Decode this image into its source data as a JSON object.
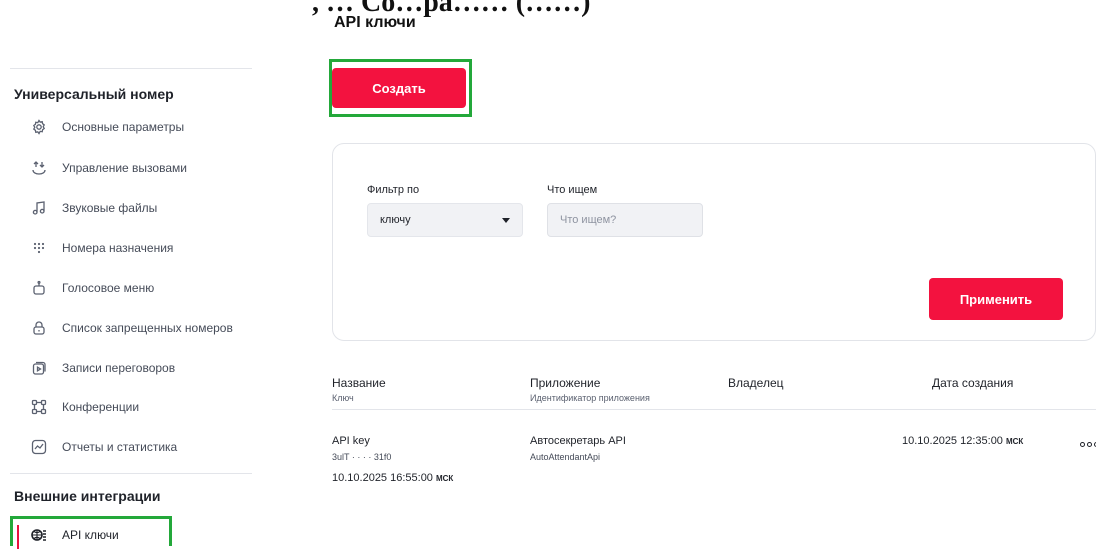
{
  "page": {
    "title_fragment": ", … Со…ра…… (……)",
    "title": "API ключи",
    "create_label": "Создать"
  },
  "sidebar": {
    "group1_title": "Универсальный номер",
    "items": [
      {
        "label": "Основные параметры",
        "icon": "gear-icon"
      },
      {
        "label": "Управление вызовами",
        "icon": "call-routing-icon"
      },
      {
        "label": "Звуковые файлы",
        "icon": "music-note-icon"
      },
      {
        "label": "Номера назначения",
        "icon": "dialpad-icon"
      },
      {
        "label": "Голосовое меню",
        "icon": "robot-icon"
      },
      {
        "label": "Список запрещенных номеров",
        "icon": "lock-icon"
      },
      {
        "label": "Записи переговоров",
        "icon": "recording-icon"
      },
      {
        "label": "Конференции",
        "icon": "conference-icon"
      },
      {
        "label": "Отчеты и статистика",
        "icon": "chart-icon"
      }
    ],
    "group2_title": "Внешние интеграции",
    "active_item": {
      "label": "API ключи",
      "icon": "api-key-icon"
    }
  },
  "filter": {
    "filter_by_label": "Фильтр по",
    "filter_by_value": "ключу",
    "search_label": "Что ищем",
    "search_placeholder": "Что ищем?",
    "apply_label": "Применить"
  },
  "table": {
    "headers": {
      "name": "Название",
      "name_sub": "Ключ",
      "app": "Приложение",
      "app_sub": "Идентификатор приложения",
      "owner": "Владелец",
      "created": "Дата создания"
    },
    "rows": [
      {
        "name": "API key",
        "key_masked": "3ulT · · · · 31f0",
        "date_under_name": "10.10.2025 16:55:00",
        "app": "Автосекретарь API",
        "app_id": "AutoAttendantApi",
        "created": "10.10.2025 12:35:00",
        "tz": "МСК"
      }
    ]
  }
}
